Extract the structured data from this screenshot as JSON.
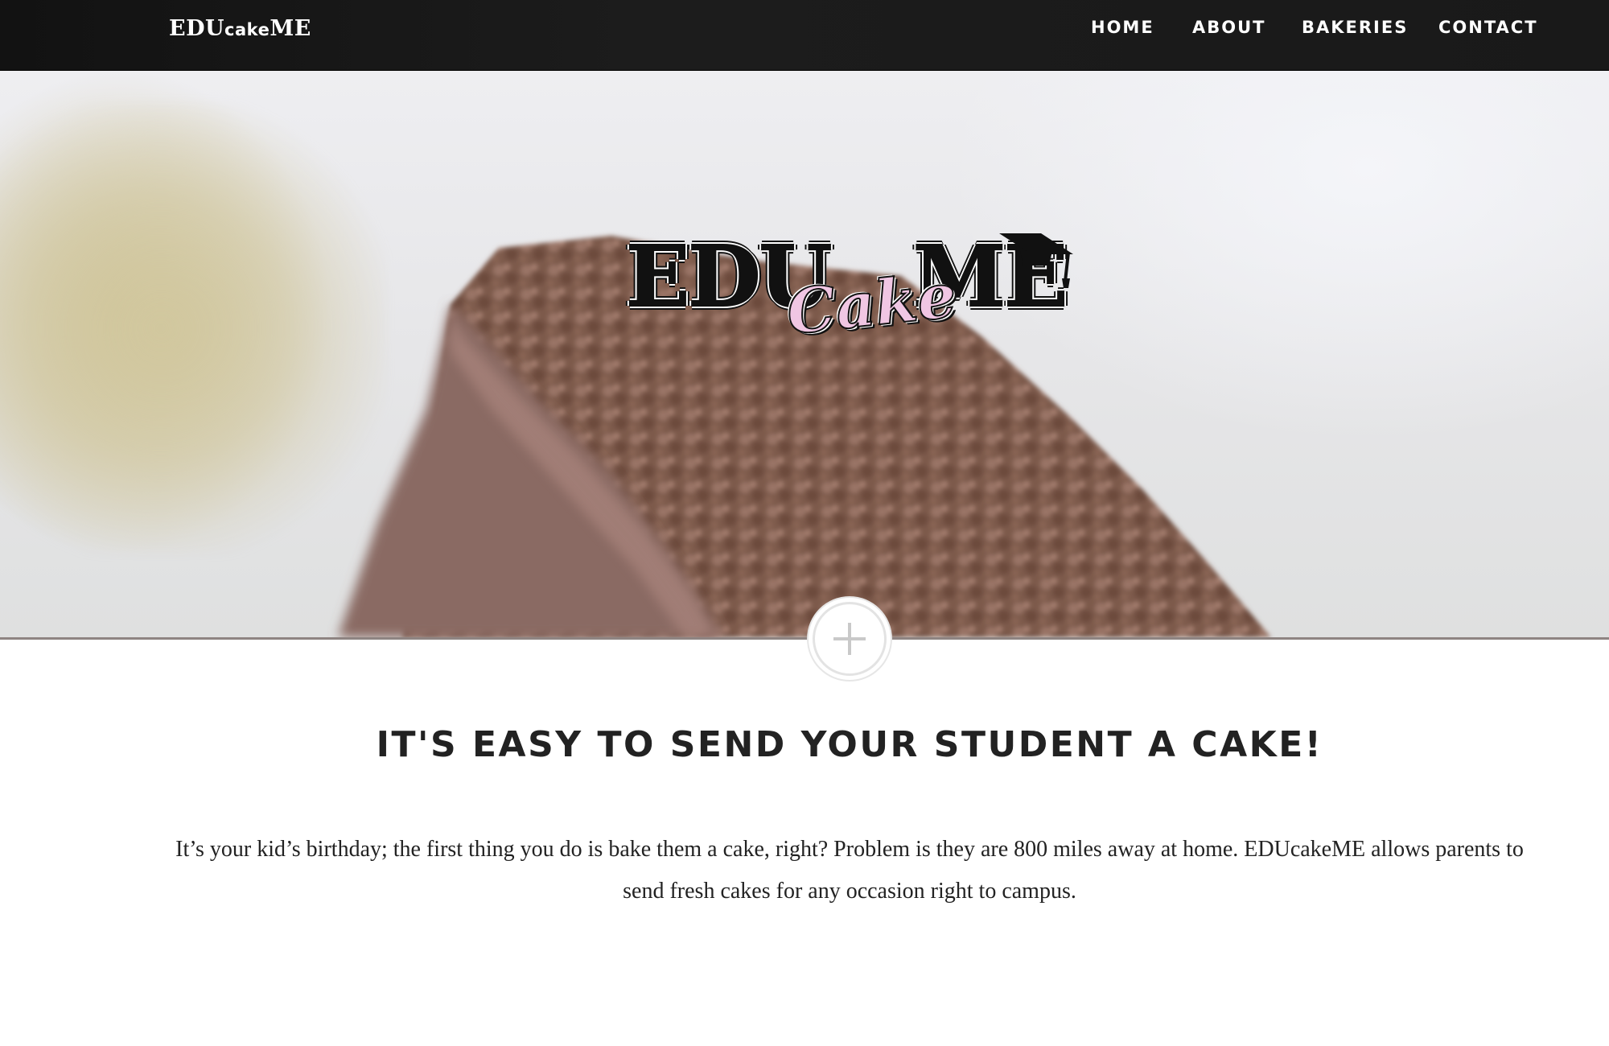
{
  "navbar": {
    "brand_main_left": "EDU",
    "brand_small": "cake",
    "brand_main_right": "ME",
    "links": [
      {
        "label": "HOME"
      },
      {
        "label": "ABOUT"
      },
      {
        "label": "BAKERIES"
      },
      {
        "label": "CONTACT"
      }
    ]
  },
  "hero": {
    "logo_edu": "EDU",
    "logo_cake": "Cake",
    "logo_me": "ME",
    "background_image": "blurred-chocolate-cake-slice",
    "expand_icon": "plus-icon"
  },
  "content": {
    "heading": "IT'S EASY TO SEND YOUR STUDENT A CAKE!",
    "body": "It’s your kid’s birthday; the first thing you do is bake them a cake, right? Problem is they are 800 miles away at home. EDUcakeME allows parents to send fresh cakes for any occasion right to campus."
  },
  "colors": {
    "navbar_bg": "#1a1a1a",
    "logo_pink": "#f0c6e3",
    "text_dark": "#222222",
    "plus_grey": "#c9c9c9"
  }
}
